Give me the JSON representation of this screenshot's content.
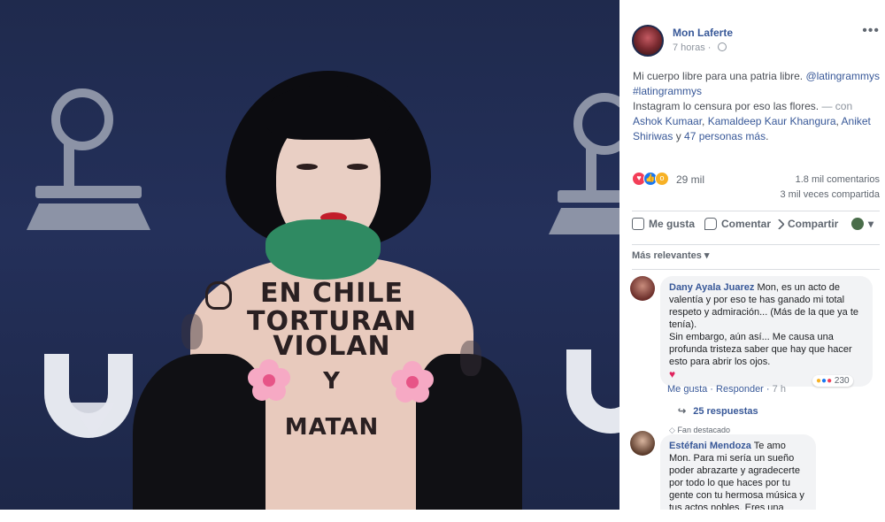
{
  "photo": {
    "body_text": [
      "EN CHILE",
      "TORTURAN",
      "VIOLAN",
      "Y",
      "MATAN"
    ],
    "colors": {
      "backdrop": "#1f2a4d",
      "scarf": "#2f8a62",
      "logo": "#8c93a6"
    }
  },
  "post": {
    "author": "Mon Laferte",
    "time": "7 horas",
    "privacy_icon": "globe-icon",
    "more_icon": "more-dots-icon",
    "text": {
      "line1_text": "Mi cuerpo libre para una patria libre. ",
      "line1_mention": "@latingrammys",
      "hashtag": "#latingrammys",
      "line3": "Instagram lo censura por eso las flores.",
      "with_prefix": " — con",
      "tag1": "Ashok Kumaar",
      "sep1": ", ",
      "tag2": "Kamaldeep Kaur Khangura",
      "sep2": ", ",
      "tag3": "Aniket Shiriwas",
      "and": " y ",
      "others": "47 personas más",
      "end": "."
    },
    "reactions": {
      "count": "29 mil",
      "types": [
        "love",
        "like",
        "wow"
      ]
    },
    "comments_count": "1.8 mil comentarios",
    "shares_count": "3 mil veces compartida",
    "actions": {
      "like": "Me gusta",
      "comment": "Comentar",
      "share": "Compartir"
    },
    "sort_label": "Más relevantes ▾"
  },
  "comments": [
    {
      "name": "Dany Ayala Juarez",
      "text": " Mon, es un acto de valentía y por eso te has ganado mi total respeto y admiración... (Más de la que ya te tenía).",
      "text2": "Sin embargo, aún así... Me causa una profunda tristeza saber que hay que hacer esto para abrir los ojos.",
      "heart": "♥",
      "like": "Me gusta",
      "reply": "Responder",
      "time": "7 h",
      "reaction_count": "230",
      "replies": "25 respuestas"
    },
    {
      "badge": "Fan destacado",
      "name": "Estéfani Mendoza",
      "text": " Te amo Mon. Para mi sería un sueño poder abrazarte y agradecerte por todo lo que haces por tu gente con tu hermosa música y tus actos nobles. Eres una mujer valiente."
    }
  ],
  "colors": {
    "link": "#385898",
    "text": "#1c1e21",
    "muted": "#8d949e",
    "bubble": "#f2f3f5"
  }
}
